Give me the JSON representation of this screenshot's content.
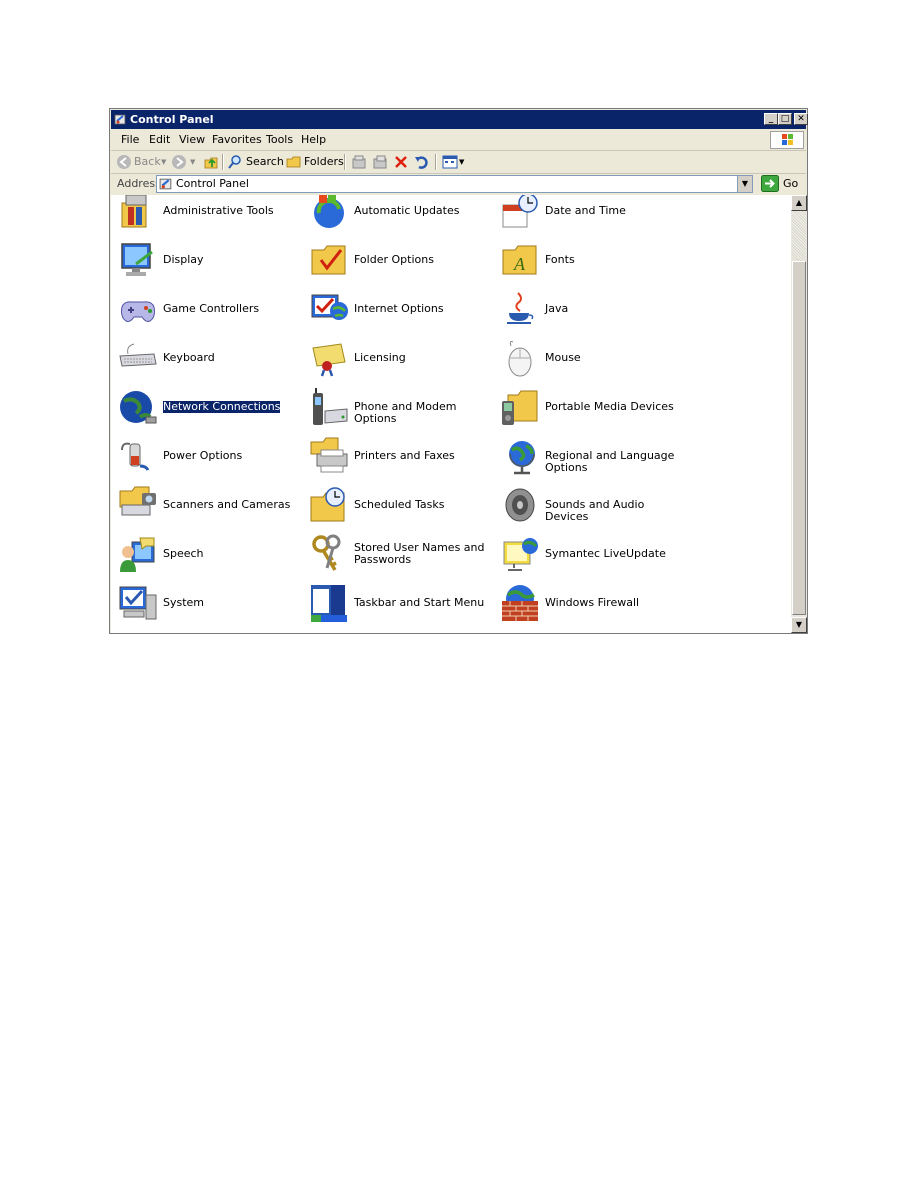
{
  "window": {
    "title": "Control Panel",
    "minimize": "_",
    "maximize": "□",
    "close": "✕"
  },
  "menu": [
    "File",
    "Edit",
    "View",
    "Favorites",
    "Tools",
    "Help"
  ],
  "toolbar": {
    "back": "Back",
    "search": "Search",
    "folders": "Folders"
  },
  "address": {
    "label": "Address",
    "value": "Control Panel",
    "go": "Go"
  },
  "items": [
    {
      "label": "Administrative Tools",
      "icon": "administrative-tools-icon"
    },
    {
      "label": "Automatic Updates",
      "icon": "automatic-updates-icon"
    },
    {
      "label": "Date and Time",
      "icon": "date-time-icon"
    },
    {
      "label": "Display",
      "icon": "display-icon"
    },
    {
      "label": "Folder Options",
      "icon": "folder-options-icon"
    },
    {
      "label": "Fonts",
      "icon": "fonts-folder-icon"
    },
    {
      "label": "Game Controllers",
      "icon": "gamepad-icon"
    },
    {
      "label": "Internet Options",
      "icon": "internet-options-icon"
    },
    {
      "label": "Java",
      "icon": "java-cup-icon"
    },
    {
      "label": "Keyboard",
      "icon": "keyboard-icon"
    },
    {
      "label": "Licensing",
      "icon": "certificate-icon"
    },
    {
      "label": "Mouse",
      "icon": "mouse-icon"
    },
    {
      "label": "Network Connections",
      "icon": "network-globe-icon"
    },
    {
      "label": "Phone and Modem Options",
      "icon": "phone-modem-icon"
    },
    {
      "label": "Portable Media Devices",
      "icon": "portable-media-icon"
    },
    {
      "label": "Power Options",
      "icon": "power-plug-icon"
    },
    {
      "label": "Printers and Faxes",
      "icon": "printer-icon"
    },
    {
      "label": "Regional and Language Options",
      "icon": "globe-icon"
    },
    {
      "label": "Scanners and Cameras",
      "icon": "scanner-camera-icon"
    },
    {
      "label": "Scheduled Tasks",
      "icon": "scheduled-tasks-icon"
    },
    {
      "label": "Sounds and Audio Devices",
      "icon": "speaker-icon"
    },
    {
      "label": "Speech",
      "icon": "speech-icon"
    },
    {
      "label": "Stored User Names and Passwords",
      "icon": "keys-icon"
    },
    {
      "label": "Symantec LiveUpdate",
      "icon": "liveupdate-icon"
    },
    {
      "label": "System",
      "icon": "system-icon"
    },
    {
      "label": "Taskbar and Start Menu",
      "icon": "taskbar-icon"
    },
    {
      "label": "Windows Firewall",
      "icon": "firewall-icon"
    }
  ],
  "selected_item": "Network Connections"
}
